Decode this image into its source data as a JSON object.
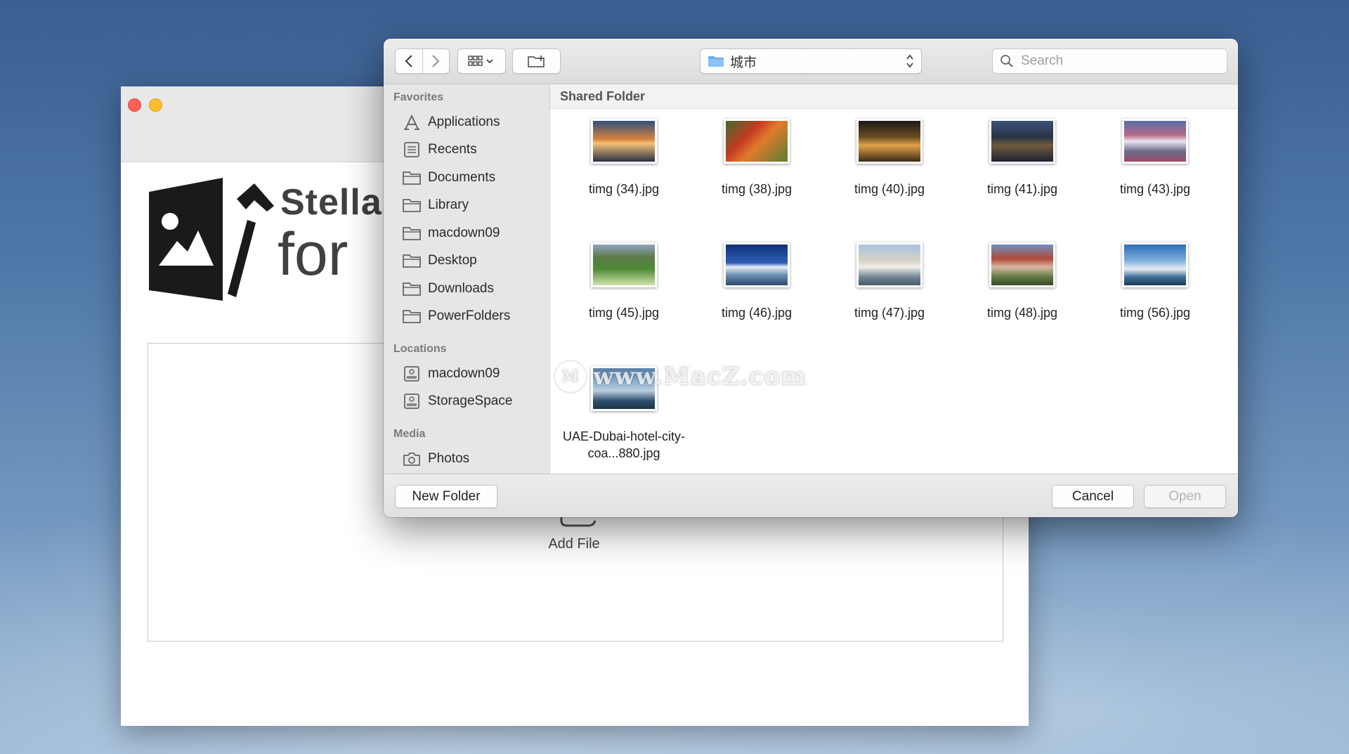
{
  "app": {
    "brand_name": "Stellar",
    "brand_sub": "for",
    "add_file_label": "Add File"
  },
  "dialog": {
    "path_label": "城市",
    "search_placeholder": "Search",
    "content_header": "Shared Folder",
    "sidebar": {
      "favorites_title": "Favorites",
      "favorites": [
        {
          "label": "Applications",
          "icon": "applications-icon"
        },
        {
          "label": "Recents",
          "icon": "recents-icon"
        },
        {
          "label": "Documents",
          "icon": "folder-icon"
        },
        {
          "label": "Library",
          "icon": "folder-icon"
        },
        {
          "label": "macdown09",
          "icon": "folder-icon"
        },
        {
          "label": "Desktop",
          "icon": "folder-icon"
        },
        {
          "label": "Downloads",
          "icon": "folder-icon"
        },
        {
          "label": "PowerFolders",
          "icon": "folder-icon"
        }
      ],
      "locations_title": "Locations",
      "locations": [
        {
          "label": "macdown09",
          "icon": "disk-icon"
        },
        {
          "label": "StorageSpace",
          "icon": "disk-icon"
        }
      ],
      "media_title": "Media",
      "media": [
        {
          "label": "Photos",
          "icon": "camera-icon"
        }
      ]
    },
    "files": [
      {
        "name": "timg (34).jpg"
      },
      {
        "name": "timg (38).jpg"
      },
      {
        "name": "timg (40).jpg"
      },
      {
        "name": "timg (41).jpg"
      },
      {
        "name": "timg (43).jpg"
      },
      {
        "name": "timg (45).jpg"
      },
      {
        "name": "timg (46).jpg"
      },
      {
        "name": "timg (47).jpg"
      },
      {
        "name": "timg (48).jpg"
      },
      {
        "name": "timg (56).jpg"
      },
      {
        "name": "UAE-Dubai-hotel-city-coa...880.jpg"
      }
    ],
    "new_folder_label": "New Folder",
    "cancel_label": "Cancel",
    "open_label": "Open"
  },
  "watermark": {
    "logo_letter": "M",
    "text": "www.MacZ.com"
  },
  "colors": {
    "close": "#fe5f57",
    "minimize": "#febc2e",
    "folder_blue": "#67a9e8"
  }
}
